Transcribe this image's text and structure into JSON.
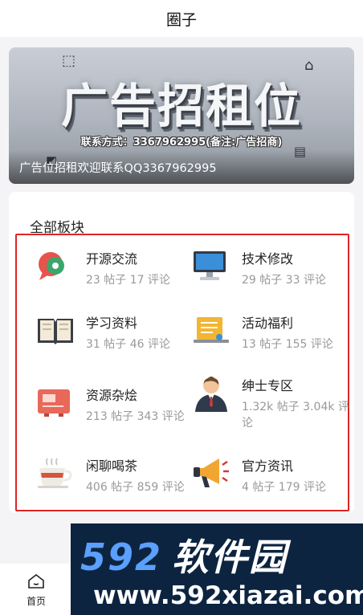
{
  "header": {
    "title": "圈子"
  },
  "banner": {
    "headline": "广告招租位",
    "contact": "联系方式：3367962995(备注:广告招商)",
    "caption": "广告位招租欢迎联系QQ3367962995"
  },
  "section": {
    "title": "全部板块"
  },
  "forums": [
    {
      "name": "开源交流",
      "stats": "23 帖子 17 评论",
      "icon": "chat-bubbles-icon"
    },
    {
      "name": "技术修改",
      "stats": "29 帖子 33 评论",
      "icon": "monitor-icon"
    },
    {
      "name": "学习资料",
      "stats": "31 帖子 46 评论",
      "icon": "open-book-icon"
    },
    {
      "name": "活动福利",
      "stats": "13 帖子 155 评论",
      "icon": "notepad-icon"
    },
    {
      "name": "资源杂烩",
      "stats": "213 帖子 343 评论",
      "icon": "ticket-card-icon"
    },
    {
      "name": "绅士专区",
      "stats": "1.32k 帖子 3.04k 评论",
      "icon": "gentleman-icon"
    },
    {
      "name": "闲聊喝茶",
      "stats": "406 帖子 859 评论",
      "icon": "tea-cup-icon"
    },
    {
      "name": "官方资讯",
      "stats": "4 帖子 179 评论",
      "icon": "megaphone-icon"
    }
  ],
  "nav": {
    "home_label": "首页"
  },
  "watermark": {
    "logo_num": "592",
    "logo_cn": "软件园",
    "url": "www.592xiazai.com"
  }
}
